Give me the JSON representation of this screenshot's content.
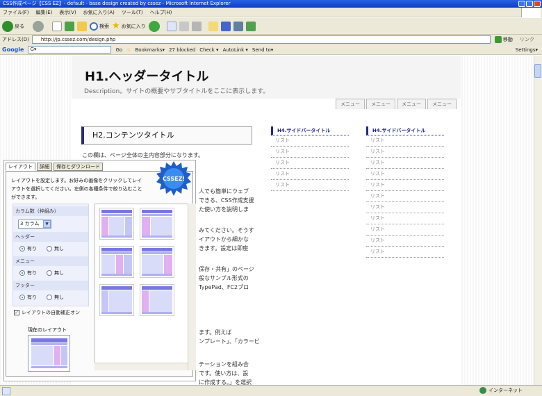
{
  "window": {
    "title": "CSS作成ページ【CSS EZ】- default - base design created by cssez - Microsoft Internet Explorer"
  },
  "menubar": [
    "ファイル(F)",
    "編集(E)",
    "表示(V)",
    "お気に入り(A)",
    "ツール(T)",
    "ヘルプ(H)"
  ],
  "toolbar": {
    "back": "戻る",
    "search": "検索",
    "favorites": "お気に入り"
  },
  "addressbar": {
    "label": "アドレス(D)",
    "url": "http://jp.cssez.com/design.php",
    "go": "移動",
    "links": "リンク"
  },
  "googlebar": {
    "logo": "Google",
    "search_value": "G▾",
    "go": "Go",
    "bookmarks": "Bookmarks▾",
    "blocked": "27 blocked",
    "check": "Check ▾",
    "autolink": "AutoLink ▾",
    "sendto": "Send to▾",
    "settings": "Settings▾"
  },
  "page": {
    "h1": "H1.ヘッダータイトル",
    "description": "Description。サイトの概要やサブタイトルをここに表示します。",
    "menu_tabs": [
      "メニュー",
      "メニュー",
      "メニュー",
      "メニュー"
    ],
    "h2": "H2.コンテンツタイトル",
    "intro": "この欄は、ページ全体の主内容部分になります。",
    "main_lines": [
      "人でも簡単にウェブ",
      "できる、CSS作成支援",
      "た使い方を説明しま",
      "みてください。そうす",
      "イアウトから細かな",
      "きます。設定は即座",
      "保存・共有」のページ",
      "般なサンプル形式の",
      "TypePad、FC2ブロ",
      "ます。例えば",
      "ンプレート」、「カラービ",
      "テーションを組み合",
      "です。使い方は、設",
      "に作成する。」を選択"
    ],
    "sidebar1": {
      "heading": "H4.サイドバータイトル",
      "items": [
        "リスト",
        "リスト",
        "リスト",
        "リスト",
        "リスト"
      ]
    },
    "sidebar2": {
      "heading": "H4.サイドバータイトル",
      "items": [
        "リスト",
        "リスト",
        "リスト",
        "リスト",
        "リスト",
        "リスト",
        "リスト",
        "リスト",
        "リスト",
        "リスト",
        "リスト"
      ]
    }
  },
  "panel": {
    "tabs": [
      "レイアウト",
      "詳細",
      "保存とダウンロード"
    ],
    "instruction": "レイアウトを設定します。お好みの画像をクリックしてレイアウトを選択してください。左側の各種条件で絞り込むことができます。",
    "badge": "CSSEZ!",
    "columns_label": "カラム数（枠組み）",
    "columns_value": "3 カラム",
    "header_label": "ヘッダー",
    "menu_label": "メニュー",
    "footer_label": "フッター",
    "yes": "有り",
    "no": "無し",
    "autofix": "レイアウトの自動補正オン",
    "current_layout": "現在のレイアウト"
  },
  "statusbar": {
    "zone": "インターネット"
  },
  "colors": {
    "accent_blue": "#1f2a8a",
    "thumb_header": "#7878e0",
    "thumb_pink": "#e0b0f0",
    "thumb_light": "#d8dcf8"
  }
}
